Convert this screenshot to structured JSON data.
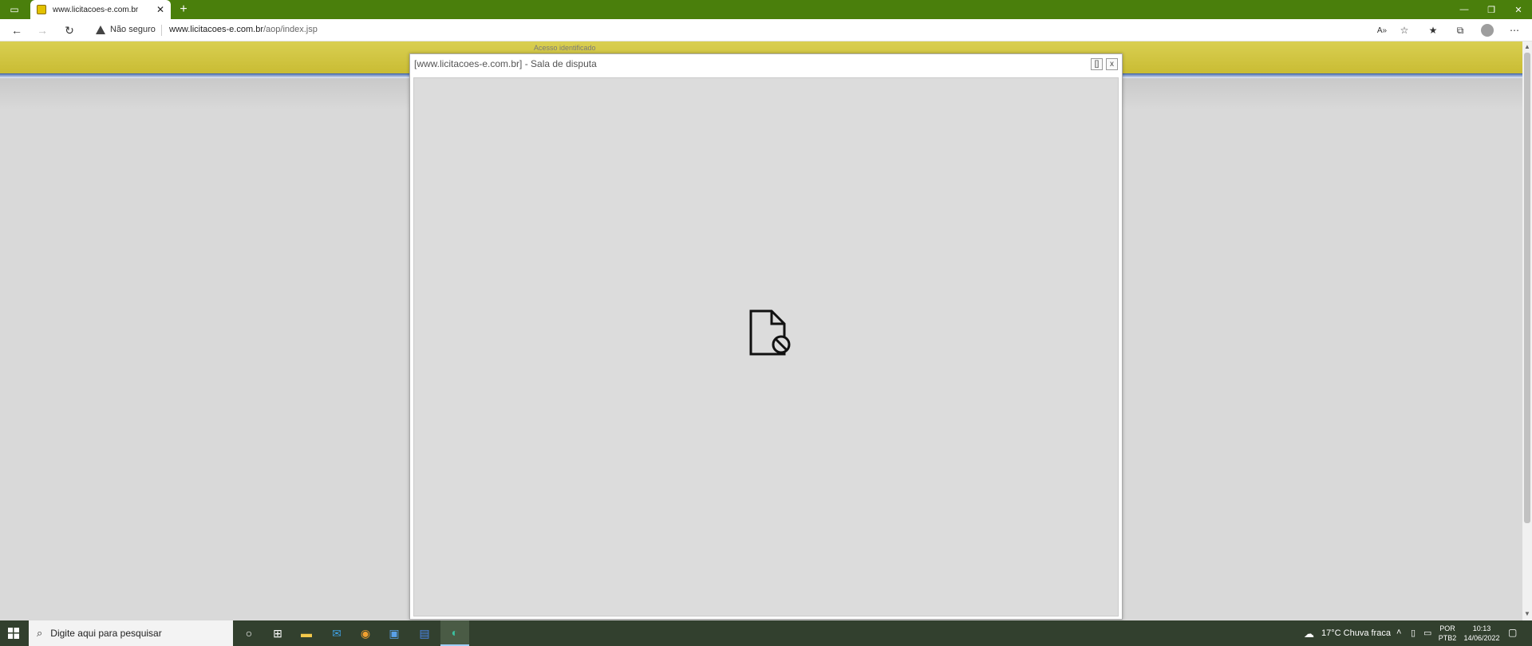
{
  "browser": {
    "tab_title": "www.licitacoes-e.com.br",
    "security_label": "Não seguro",
    "url_host": "www.licitacoes-e.com.br",
    "url_path": "/aop/index.jsp",
    "new_tab_symbol": "+",
    "tab_close_symbol": "✕",
    "minimize_symbol": "—",
    "restore_symbol": "❐",
    "close_symbol": "✕"
  },
  "page": {
    "acesso_text": "Acesso identificado"
  },
  "modal": {
    "title": "[www.licitacoes-e.com.br] - Sala de disputa",
    "maximize_label": "[]",
    "close_label": "x"
  },
  "taskbar": {
    "search_placeholder": "Digite aqui para pesquisar",
    "weather": "17°C  Chuva fraca",
    "lang_top": "POR",
    "lang_bottom": "PTB2",
    "time": "10:13",
    "date": "14/06/2022"
  },
  "colors": {
    "tabstrip": "#4a7f0c",
    "header_yellow": "#d4c93f",
    "taskbar": "#32402e"
  }
}
